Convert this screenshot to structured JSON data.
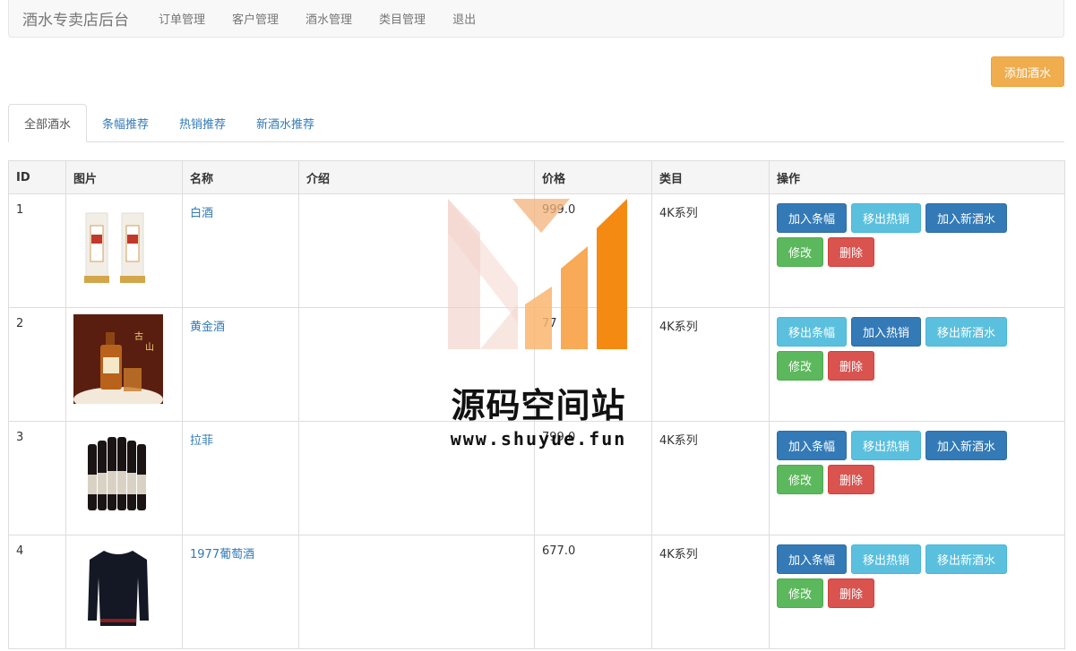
{
  "navbar": {
    "brand": "酒水专卖店后台",
    "links": [
      "订单管理",
      "客户管理",
      "酒水管理",
      "类目管理",
      "退出"
    ]
  },
  "add_button": "添加酒水",
  "tabs": [
    "全部酒水",
    "条幅推荐",
    "热销推荐",
    "新酒水推荐"
  ],
  "table": {
    "headers": [
      "ID",
      "图片",
      "名称",
      "介绍",
      "价格",
      "类目",
      "操作"
    ],
    "rows": [
      {
        "id": "1",
        "image": "baijiu-bottles",
        "name": "白酒",
        "intro": "",
        "price": "999.0",
        "category": "4K系列",
        "actions": [
          "加入条幅",
          "移出热销",
          "加入新酒水"
        ],
        "edit": "修改",
        "delete": "删除"
      },
      {
        "id": "2",
        "image": "golden-liquor-bottle",
        "name": "黄金酒",
        "intro": "",
        "price": "77",
        "category": "4K系列",
        "actions": [
          "移出条幅",
          "加入热销",
          "移出新酒水"
        ],
        "edit": "修改",
        "delete": "删除"
      },
      {
        "id": "3",
        "image": "wine-bottles",
        "name": "拉菲",
        "intro": "",
        "price": "799.0",
        "category": "4K系列",
        "actions": [
          "加入条幅",
          "移出热销",
          "加入新酒水"
        ],
        "edit": "修改",
        "delete": "删除"
      },
      {
        "id": "4",
        "image": "black-sweater",
        "name": "1977葡萄酒",
        "intro": "",
        "price": "677.0",
        "category": "4K系列",
        "actions": [
          "加入条幅",
          "移出热销",
          "移出新酒水"
        ],
        "edit": "修改",
        "delete": "删除"
      }
    ]
  },
  "watermark": {
    "title": "源码空间站",
    "url": "www.shuyue.fun"
  },
  "colors": {
    "primary": "#337ab7",
    "info": "#5bc0de",
    "success": "#5cb85c",
    "danger": "#d9534f",
    "warning": "#f0ad4e"
  }
}
